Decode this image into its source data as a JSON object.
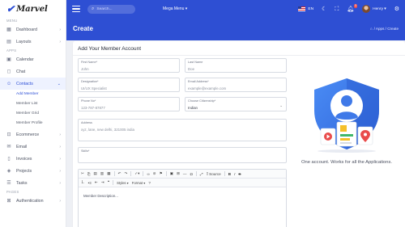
{
  "brand": {
    "name": "Marvel"
  },
  "sidebar": {
    "section_menu": "MENU",
    "section_apps": "APPS",
    "section_pages": "PAGES",
    "menu_items": [
      {
        "label": "Dashboard",
        "icon": "dashboard-icon",
        "has_chevron": true
      },
      {
        "label": "Layouts",
        "icon": "layouts-icon",
        "has_chevron": true
      }
    ],
    "app_items": [
      {
        "label": "Calendar",
        "icon": "calendar-icon"
      },
      {
        "label": "Chat",
        "icon": "chat-icon"
      },
      {
        "label": "Contacts",
        "icon": "contacts-icon"
      }
    ],
    "contacts_sub": [
      "Add Member",
      "Member List",
      "Member Grid",
      "Member Profile"
    ],
    "more_items": [
      {
        "label": "Ecommerce",
        "icon": "cart-icon"
      },
      {
        "label": "Email",
        "icon": "mail-icon"
      },
      {
        "label": "Invoices",
        "icon": "invoice-icon"
      },
      {
        "label": "Projects",
        "icon": "projects-icon"
      },
      {
        "label": "Tasks",
        "icon": "tasks-icon"
      }
    ],
    "page_items": [
      {
        "label": "Authentication",
        "icon": "lock-icon"
      }
    ]
  },
  "topbar": {
    "search_placeholder": "Search...",
    "mega_menu": "Mega Menu ▾",
    "language": "EN",
    "notification_count": "3",
    "user_name": "Henry ▾"
  },
  "page": {
    "title": "Create",
    "breadcrumb": "/ Apps / Create"
  },
  "form": {
    "title": "Add Your Member Account",
    "fields": {
      "first_name": {
        "label": "First Name*",
        "value": "John"
      },
      "last_name": {
        "label": "Last Name",
        "value": "Doe"
      },
      "designation": {
        "label": "Designation*",
        "value": "UI/UX Specialist"
      },
      "email": {
        "label": "Email Address*",
        "value": "example@example.com"
      },
      "phone": {
        "label": "Phone No*",
        "value": "123-787-87877"
      },
      "citizenship": {
        "label": "Choose Citizenship*",
        "value": "Indian"
      },
      "address": {
        "label": "Address",
        "value": "xyz, lane, new delhi, 321005 india"
      },
      "skills": {
        "label": "Skills*",
        "value": ""
      }
    },
    "editor": {
      "source_label": "Source",
      "styles_label": "Styles",
      "format_label": "Format",
      "content": "Member Description..."
    }
  },
  "promo": {
    "tagline": "One account. Works for all the Applications."
  },
  "colors": {
    "primary": "#2e4fd3",
    "shield": "#3d7cf0",
    "card_red": "#e94b4b",
    "card_green": "#41b86b",
    "card_yellow": "#f5c02a"
  }
}
